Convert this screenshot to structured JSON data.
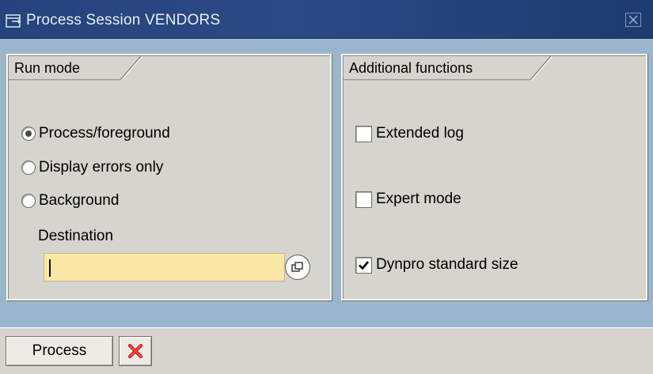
{
  "window": {
    "title": "Process Session VENDORS",
    "close_icon": "close-icon"
  },
  "run_mode": {
    "group_title": "Run mode",
    "options": [
      {
        "label": "Process/foreground",
        "selected": true
      },
      {
        "label": "Display errors only",
        "selected": false
      },
      {
        "label": "Background",
        "selected": false
      }
    ],
    "destination_label": "Destination",
    "destination_value": "",
    "help_icon": "f4-help-icon"
  },
  "additional_functions": {
    "group_title": "Additional functions",
    "options": [
      {
        "label": "Extended log",
        "checked": false
      },
      {
        "label": "Expert mode",
        "checked": false
      },
      {
        "label": "Dynpro standard size",
        "checked": true
      }
    ]
  },
  "footer": {
    "process_label": "Process",
    "cancel_icon": "cancel-icon"
  },
  "colors": {
    "title_bar": "#2b4a85",
    "dialog_bg": "#9bb6cc",
    "group_bg": "#d5d4ce",
    "input_bg": "#fbe7a6",
    "cancel_red": "#d41c1c"
  }
}
